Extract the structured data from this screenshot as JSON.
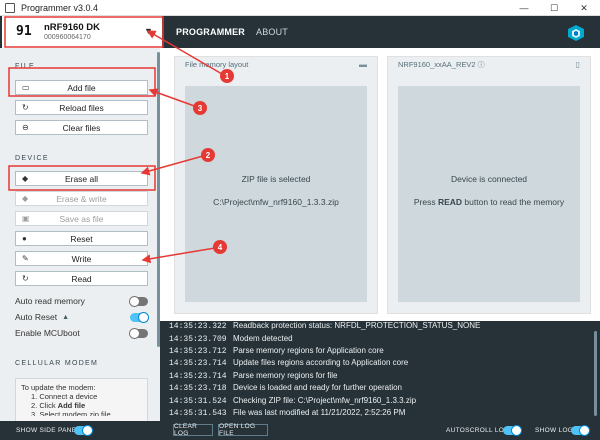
{
  "window": {
    "title": "Programmer v3.0.4",
    "minimize": "—",
    "maximize": "☐",
    "close": "✕"
  },
  "device": {
    "logo": "91",
    "name": "nRF9160 DK",
    "serial": "000960064170",
    "caret_icon": "▼"
  },
  "tabs": [
    {
      "label": "PROGRAMMER"
    },
    {
      "label": "ABOUT"
    }
  ],
  "sidebar": {
    "file_section": "FILE",
    "file_buttons": [
      {
        "label": "Add file",
        "icon": "folder-icon"
      },
      {
        "label": "Reload files",
        "icon": "reload-icon"
      },
      {
        "label": "Clear files",
        "icon": "clear-icon"
      }
    ],
    "device_section": "DEVICE",
    "device_buttons": [
      {
        "label": "Erase all",
        "icon": "eraser-icon",
        "enabled": true
      },
      {
        "label": "Erase & write",
        "icon": "eraser-icon",
        "enabled": false
      },
      {
        "label": "Save as file",
        "icon": "save-icon",
        "enabled": false
      },
      {
        "label": "Reset",
        "icon": "dot-icon",
        "enabled": true
      },
      {
        "label": "Write",
        "icon": "pencil-icon",
        "enabled": true
      },
      {
        "label": "Read",
        "icon": "refresh-icon",
        "enabled": true
      }
    ],
    "toggles": [
      {
        "label": "Auto read memory",
        "on": false
      },
      {
        "label": "Auto Reset",
        "on": true,
        "warning": "▲"
      },
      {
        "label": "Enable MCUboot",
        "on": false
      }
    ],
    "modem_section": "CELLULAR MODEM",
    "modem_intro": "To update the modem:",
    "modem_step1": "1. Connect a device",
    "modem_step2_prefix": "2. Click ",
    "modem_step2_bold": "Add file",
    "modem_step3": "3. Select modem zip file"
  },
  "panels": {
    "file_memory": {
      "title": "File memory layout",
      "status": "ZIP file is selected",
      "path": "C:\\Project\\mfw_nrf9160_1.3.3.zip"
    },
    "device_memory": {
      "title": "NRF9160_xxAA_REV2",
      "status": "Device is connected",
      "hint_prefix": "Press ",
      "hint_bold": "READ",
      "hint_suffix": " button to read the memory"
    }
  },
  "log": [
    {
      "time": "14:35:23.322",
      "message": "Readback protection status: NRFDL_PROTECTION_STATUS_NONE"
    },
    {
      "time": "14:35:23.709",
      "message": "Modem detected"
    },
    {
      "time": "14:35:23.712",
      "message": "Parse memory regions for Application core"
    },
    {
      "time": "14:35:23.714",
      "message": "Update files regions according to Application core"
    },
    {
      "time": "14:35:23.714",
      "message": "Parse memory regions for file"
    },
    {
      "time": "14:35:23.718",
      "message": "Device is loaded and ready for further operation"
    },
    {
      "time": "14:35:31.524",
      "message": "Checking ZIP file: C:\\Project\\mfw_nrf9160_1.3.3.zip"
    },
    {
      "time": "14:35:31.543",
      "message": "File was last modified at 11/21/2022, 2:52:26 PM"
    }
  ],
  "footer": {
    "show_side_panel": "SHOW SIDE PANEL",
    "clear_log": "CLEAR LOG",
    "open_log_file": "OPEN LOG FILE",
    "autoscroll_log": "AUTOSCROLL LOG",
    "show_log": "SHOW LOG"
  },
  "annotations": [
    "1",
    "2",
    "3",
    "4"
  ],
  "colors": {
    "header": "#263238",
    "sidebar": "#eceff1",
    "accent": "#00a9ce",
    "annotation": "#e53935"
  }
}
